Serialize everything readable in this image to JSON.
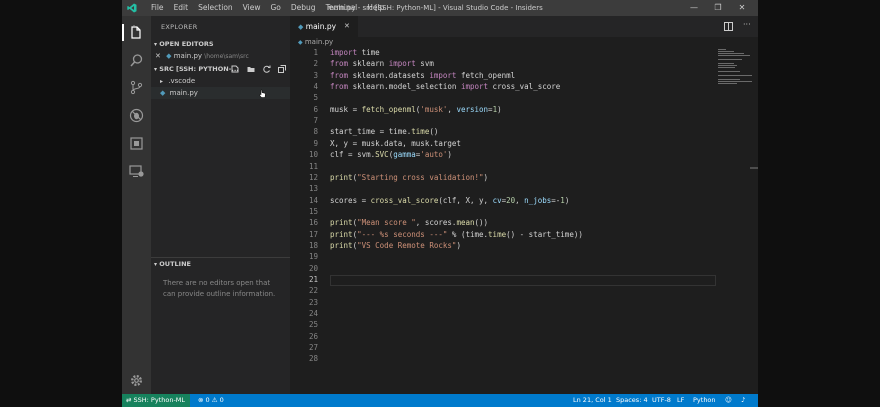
{
  "window": {
    "title": "main.py - src [SSH: Python-ML] - Visual Studio Code - Insiders",
    "menu": [
      "File",
      "Edit",
      "Selection",
      "View",
      "Go",
      "Debug",
      "Terminal",
      "Help"
    ],
    "controls": {
      "minimize": "—",
      "restore": "❐",
      "close": "✕"
    }
  },
  "activity_bar": {
    "icons": [
      "files-icon",
      "search-icon",
      "source-control-icon",
      "debug-icon",
      "extensions-icon",
      "remote-explorer-icon",
      "gear-icon"
    ]
  },
  "sidebar": {
    "title": "EXPLORER",
    "open_editors": {
      "header": "OPEN EDITORS",
      "items": [
        {
          "name": "main.py",
          "path": "\\home\\sam\\src"
        }
      ]
    },
    "folder": {
      "header": "SRC [SSH: PYTHON-...",
      "items": [
        {
          "name": ".vscode",
          "type": "folder"
        },
        {
          "name": "main.py",
          "type": "file"
        }
      ]
    },
    "outline": {
      "header": "OUTLINE",
      "message": "There are no editors open that can provide outline information."
    }
  },
  "editor": {
    "tab": "main.py",
    "breadcrumb": "main.py",
    "current_line": 21,
    "lines": [
      "import time",
      "from sklearn import svm",
      "from sklearn.datasets import fetch_openml",
      "from sklearn.model_selection import cross_val_score",
      "",
      "musk = fetch_openml('musk', version=1)",
      "",
      "start_time = time.time()",
      "X, y = musk.data, musk.target",
      "clf = svm.SVC(gamma='auto')",
      "",
      "print(\"Starting cross validation!\")",
      "",
      "scores = cross_val_score(clf, X, y, cv=20, n_jobs=-1)",
      "",
      "print(\"Mean score \", scores.mean())",
      "print(\"--- %s seconds ---\" % (time.time() - start_time))",
      "print(\"VS Code Remote Rocks\")",
      "",
      "",
      "",
      "",
      "",
      "",
      "",
      "",
      "",
      ""
    ]
  },
  "status_bar": {
    "remote": "SSH: Python-ML",
    "errors": "0",
    "warnings": "0",
    "position": "Ln 21, Col 1",
    "spaces": "Spaces: 4",
    "encoding": "UTF-8",
    "eol": "LF",
    "language": "Python"
  }
}
